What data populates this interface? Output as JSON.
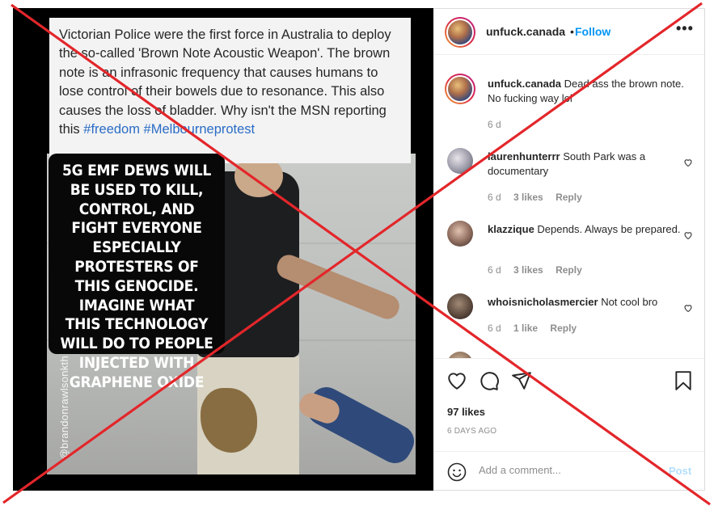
{
  "post": {
    "news_text": "Victorian Police were the first force in Australia to deploy the so-called 'Brown Note Acoustic Weapon'. The brown note is an infrasonic frequency that causes humans to lose control of their bowels due to resonance. This also causes the loss of bladder. Why isn't the MSN reporting this ",
    "news_tags": "#freedom #Melbourneprotest",
    "meme_text": "5G EMF DEWS WILL BE USED TO KILL, CONTROL, AND FIGHT EVERYONE ESPECIALLY PROTESTERS OF THIS GENOCIDE. IMAGINE WHAT THIS TECHNOLOGY WILL DO TO PEOPLE INJECTED WITH GRAPHENE OXIDE",
    "watermark": "@brandonrawlsonkth"
  },
  "header": {
    "username": "unfuck.canada",
    "separator": "•",
    "follow_label": "Follow",
    "more_label": "•••"
  },
  "comments": [
    {
      "user": "unfuck.canada",
      "text": "Dead ass the brown note. No fucking way lol",
      "time": "6 d",
      "likes": "",
      "reply": ""
    },
    {
      "user": "laurenhunterrr",
      "text": "South Park was a documentary",
      "time": "6 d",
      "likes": "3 likes",
      "reply": "Reply"
    },
    {
      "user": "klazzique",
      "text": "Depends. Always be prepared.",
      "time": "6 d",
      "likes": "3 likes",
      "reply": "Reply"
    },
    {
      "user": "whoisnicholasmercier",
      "text": "Not cool bro",
      "time": "6 d",
      "likes": "1 like",
      "reply": "Reply"
    }
  ],
  "stats": {
    "likes": "97 likes",
    "ago": "6 DAYS AGO"
  },
  "composer": {
    "placeholder": "Add a comment...",
    "post_label": "Post"
  },
  "icons": [
    "heart-icon",
    "comment-icon",
    "share-icon",
    "bookmark-icon",
    "emoji-icon",
    "more-icon"
  ],
  "colors": {
    "accent": "#0095f6",
    "overlay_x": "#e3262a",
    "post_disabled": "#b2dffc"
  }
}
